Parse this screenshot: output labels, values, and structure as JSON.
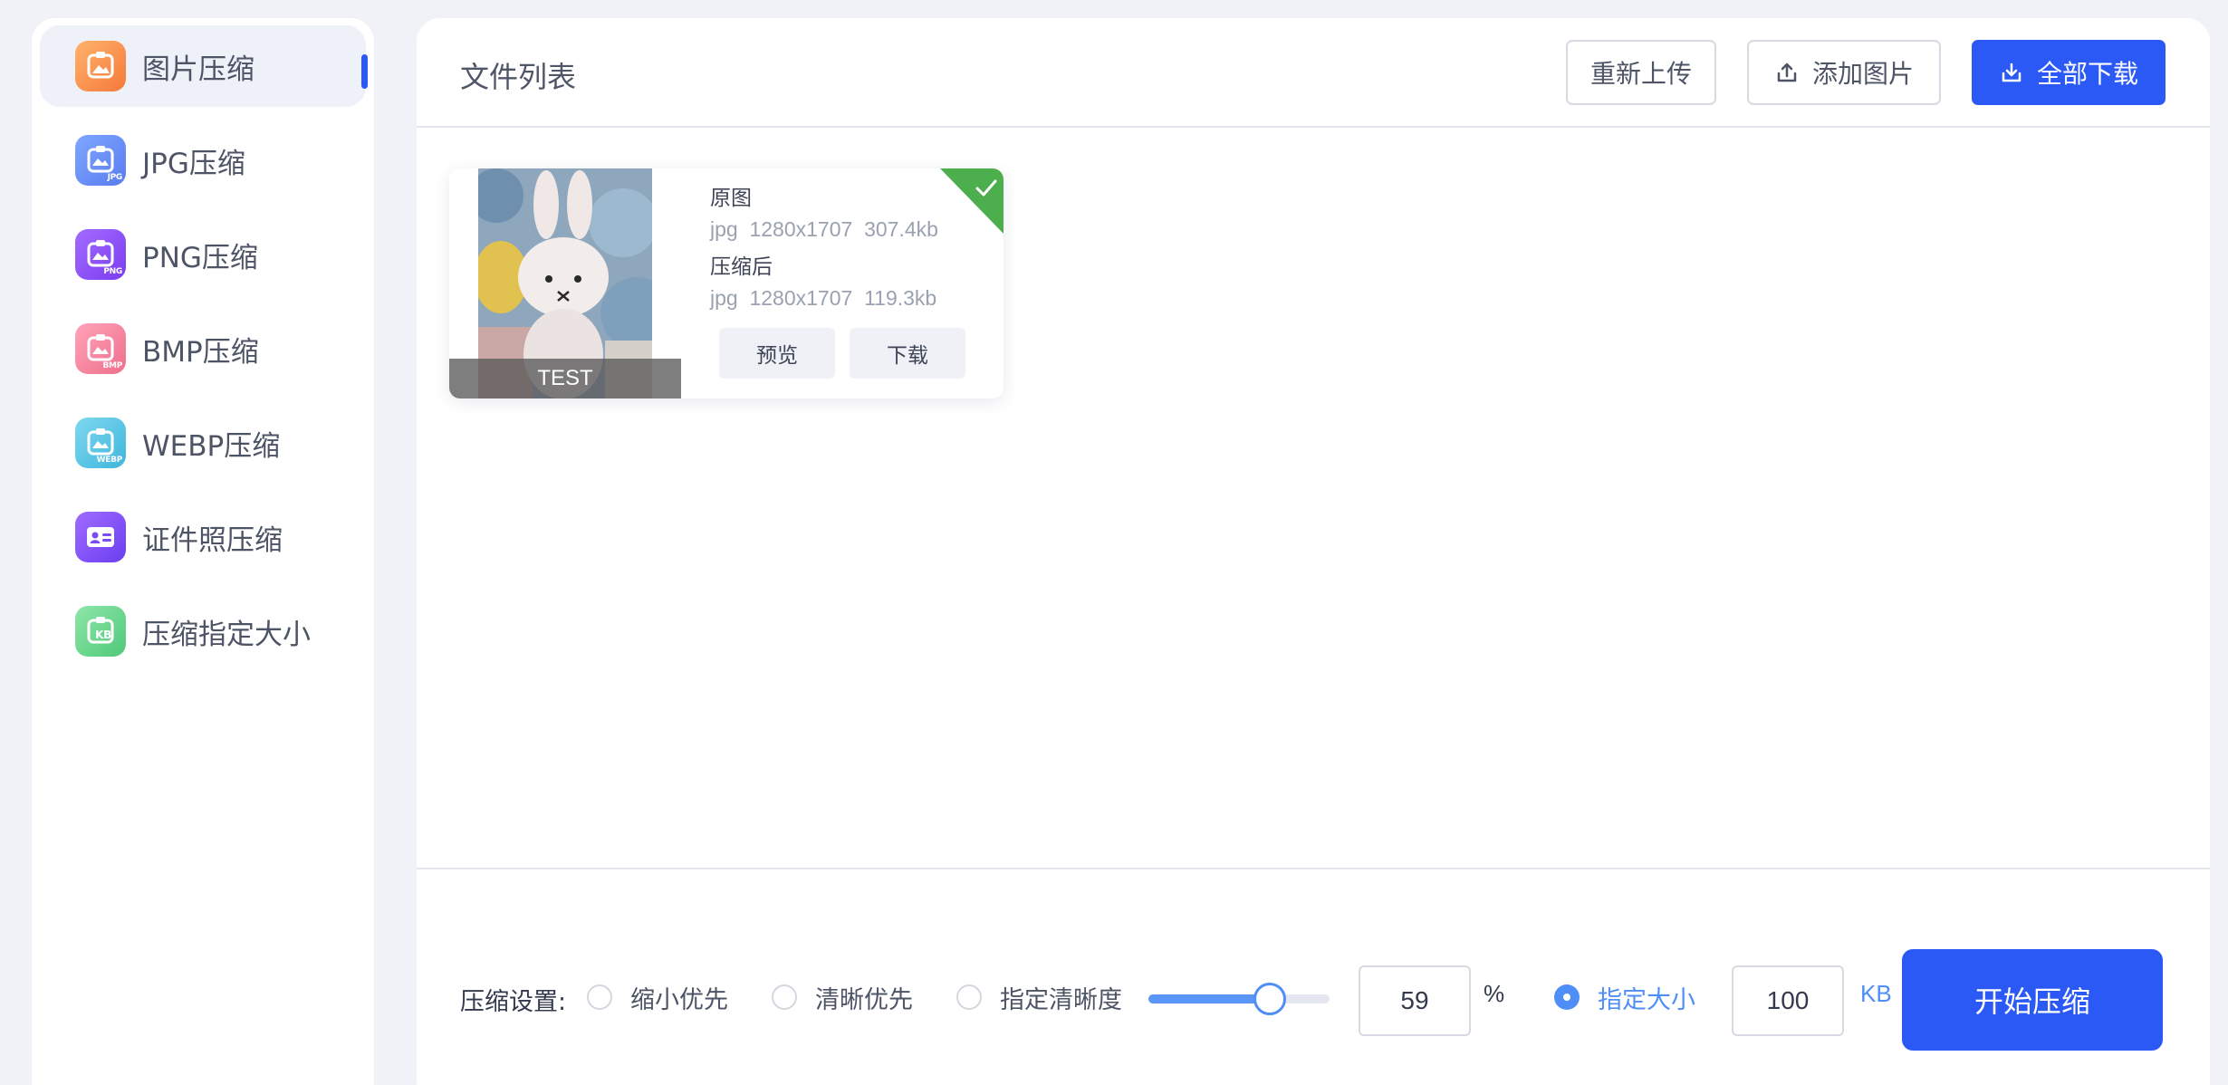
{
  "sidebar": {
    "items": [
      {
        "label": "图片压缩",
        "badge": "",
        "active": true
      },
      {
        "label": "JPG压缩",
        "badge": "JPG"
      },
      {
        "label": "PNG压缩",
        "badge": "PNG"
      },
      {
        "label": "BMP压缩",
        "badge": "BMP"
      },
      {
        "label": "WEBP压缩",
        "badge": "WEBP"
      },
      {
        "label": "证件照压缩",
        "badge": ""
      },
      {
        "label": "压缩指定大小",
        "badge": "KB"
      }
    ]
  },
  "header": {
    "title": "文件列表",
    "reupload_label": "重新上传",
    "add_label": "添加图片",
    "download_all_label": "全部下载"
  },
  "file_card": {
    "caption": "TEST",
    "original_label": "原图",
    "original_meta": "jpg  1280x1707  307.4kb",
    "compressed_label": "压缩后",
    "compressed_meta": "jpg  1280x1707  119.3kb",
    "preview_label": "预览",
    "download_label": "下载",
    "status": "done"
  },
  "settings": {
    "label": "压缩设置:",
    "options": [
      {
        "label": "缩小优先",
        "checked": false
      },
      {
        "label": "清晰优先",
        "checked": false
      },
      {
        "label": "指定清晰度",
        "checked": false
      },
      {
        "label": "指定大小",
        "checked": true
      }
    ],
    "quality_value": "59",
    "quality_fraction": 0.59,
    "quality_unit": "%",
    "size_value": "100",
    "size_unit": "KB",
    "start_label": "开始压缩"
  },
  "colors": {
    "accent": "#2b59f5",
    "radio_blue": "#4f8ef7",
    "success": "#4cae4c"
  }
}
